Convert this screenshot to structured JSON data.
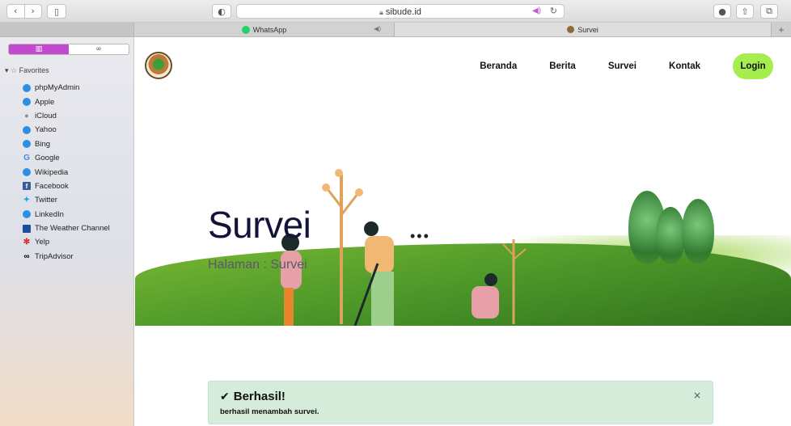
{
  "browser": {
    "url": "sibude.id",
    "tabs": [
      {
        "label": "WhatsApp"
      },
      {
        "label": "Survei"
      }
    ]
  },
  "sidebar": {
    "favorites_label": "Favorites",
    "items": [
      {
        "label": "phpMyAdmin",
        "icon": "globe-icon"
      },
      {
        "label": "Apple",
        "icon": "globe-icon"
      },
      {
        "label": "iCloud",
        "icon": "apple-icon"
      },
      {
        "label": "Yahoo",
        "icon": "globe-icon"
      },
      {
        "label": "Bing",
        "icon": "globe-icon"
      },
      {
        "label": "Google",
        "icon": "google-icon"
      },
      {
        "label": "Wikipedia",
        "icon": "globe-icon"
      },
      {
        "label": "Facebook",
        "icon": "facebook-icon"
      },
      {
        "label": "Twitter",
        "icon": "twitter-icon"
      },
      {
        "label": "LinkedIn",
        "icon": "globe-icon"
      },
      {
        "label": "The Weather Channel",
        "icon": "weather-channel-icon"
      },
      {
        "label": "Yelp",
        "icon": "yelp-icon"
      },
      {
        "label": "TripAdvisor",
        "icon": "tripadvisor-icon"
      }
    ]
  },
  "site": {
    "nav": [
      {
        "label": "Beranda"
      },
      {
        "label": "Berita"
      },
      {
        "label": "Survei"
      },
      {
        "label": "Kontak"
      }
    ],
    "login_label": "Login",
    "accent_color": "#a6ee4f"
  },
  "hero": {
    "title": "Survei",
    "subtitle": "Halaman : Survei"
  },
  "alert": {
    "title": "Berhasil!",
    "message": "berhasil menambah survei.",
    "close": "×",
    "bg_color": "#d4ecd9"
  }
}
